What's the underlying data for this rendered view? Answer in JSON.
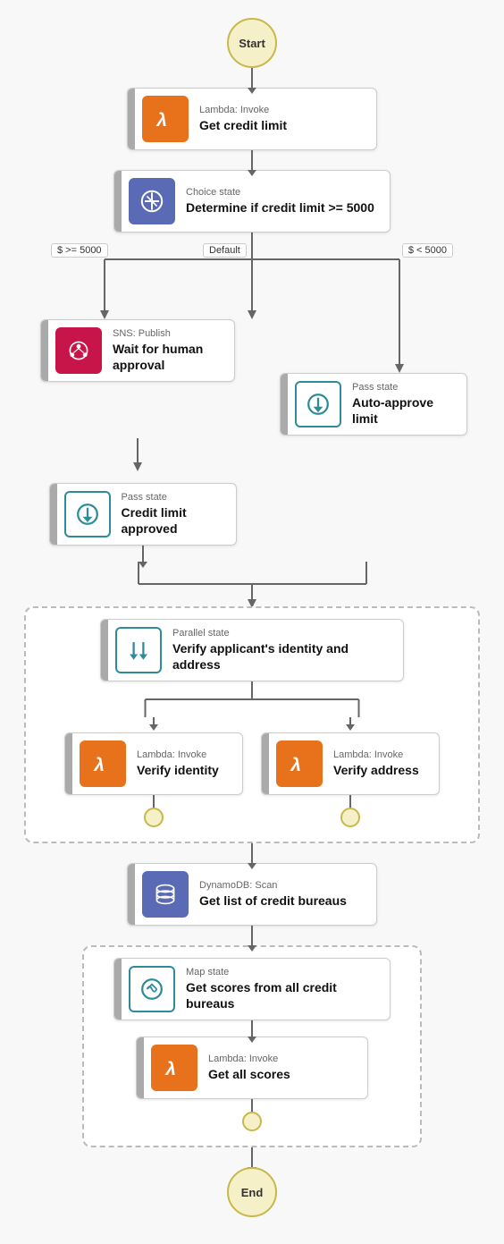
{
  "nodes": {
    "start": "Start",
    "end": "End",
    "lambda1": {
      "subtitle": "Lambda: Invoke",
      "title": "Get credit limit"
    },
    "choice": {
      "subtitle": "Choice state",
      "title": "Determine if credit limit >= 5000"
    },
    "sns": {
      "subtitle": "SNS: Publish",
      "title": "Wait for human approval"
    },
    "pass_approved": {
      "subtitle": "Pass state",
      "title": "Credit limit approved"
    },
    "pass_auto": {
      "subtitle": "Pass state",
      "title": "Auto-approve limit"
    },
    "parallel": {
      "subtitle": "Parallel state",
      "title": "Verify applicant's identity and address"
    },
    "lambda_identity": {
      "subtitle": "Lambda: Invoke",
      "title": "Verify identity"
    },
    "lambda_address": {
      "subtitle": "Lambda: Invoke",
      "title": "Verify address"
    },
    "dynamo": {
      "subtitle": "DynamoDB: Scan",
      "title": "Get list of credit bureaus"
    },
    "map": {
      "subtitle": "Map state",
      "title": "Get scores from all credit bureaus"
    },
    "lambda_scores": {
      "subtitle": "Lambda: Invoke",
      "title": "Get all scores"
    }
  },
  "branch_labels": {
    "left": "$ >= 5000",
    "default": "Default",
    "right": "$ < 5000"
  },
  "colors": {
    "connector": "#666666",
    "terminal_bg": "#f5f0c8",
    "terminal_border": "#c8b84a",
    "orange": "#e8721c",
    "pink": "#c7154a",
    "blue_purple": "#5b6ab5",
    "teal": "#2e7d8f",
    "teal_border": "#2e8b9a"
  }
}
